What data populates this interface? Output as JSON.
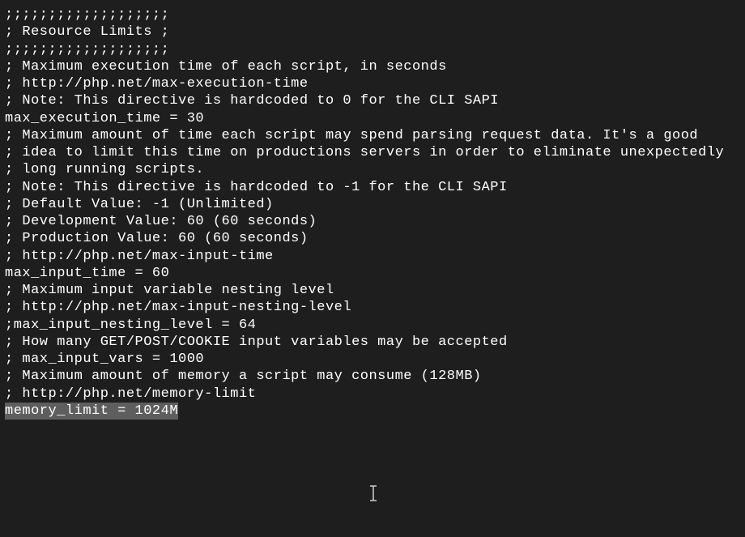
{
  "config": {
    "lines": [
      ";;;;;;;;;;;;;;;;;;;",
      "; Resource Limits ;",
      ";;;;;;;;;;;;;;;;;;;",
      "",
      "; Maximum execution time of each script, in seconds",
      "; http://php.net/max-execution-time",
      "; Note: This directive is hardcoded to 0 for the CLI SAPI",
      "max_execution_time = 30",
      "",
      "; Maximum amount of time each script may spend parsing request data. It's a good",
      "; idea to limit this time on productions servers in order to eliminate unexpectedly",
      "; long running scripts.",
      "; Note: This directive is hardcoded to -1 for the CLI SAPI",
      "; Default Value: -1 (Unlimited)",
      "; Development Value: 60 (60 seconds)",
      "; Production Value: 60 (60 seconds)",
      "; http://php.net/max-input-time",
      "max_input_time = 60",
      "",
      "; Maximum input variable nesting level",
      "; http://php.net/max-input-nesting-level",
      ";max_input_nesting_level = 64",
      "",
      "; How many GET/POST/COOKIE input variables may be accepted",
      "; max_input_vars = 1000",
      "",
      "; Maximum amount of memory a script may consume (128MB)",
      "; http://php.net/memory-limit"
    ],
    "highlighted_line": "memory_limit = 1024",
    "highlighted_tail": "M"
  }
}
